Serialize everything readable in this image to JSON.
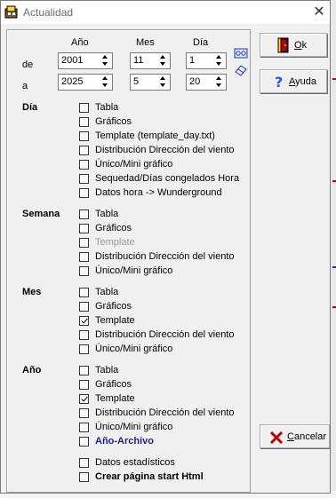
{
  "window": {
    "title": "Actualidad",
    "close_label": "✕"
  },
  "date_range": {
    "headers": {
      "year": "Año",
      "month": "Mes",
      "day": "Día"
    },
    "from_label": "de",
    "to_label": "a",
    "from": {
      "year": "2001",
      "month": "11",
      "day": "1"
    },
    "to": {
      "year": "2025",
      "month": "5",
      "day": "20"
    }
  },
  "buttons": {
    "ok": "Ok",
    "help": "Ayuda",
    "cancel": "Cancelar"
  },
  "sections": {
    "dia": {
      "title": "Día",
      "items": [
        {
          "label": "Tabla",
          "checked": false,
          "disabled": false
        },
        {
          "label": "Gráficos",
          "checked": false,
          "disabled": false
        },
        {
          "label": "Template (template_day.txt)",
          "checked": false,
          "disabled": false
        },
        {
          "label": "Distribución Dirección del viento",
          "checked": false,
          "disabled": false
        },
        {
          "label": "Único/Mini gráfico",
          "checked": false,
          "disabled": false
        },
        {
          "label": "Sequedad/Días congelados Hora",
          "checked": false,
          "disabled": false
        },
        {
          "label": "Datos hora -> Wunderground",
          "checked": false,
          "disabled": false
        }
      ]
    },
    "semana": {
      "title": "Semana",
      "items": [
        {
          "label": "Tabla",
          "checked": false,
          "disabled": false
        },
        {
          "label": "Gráficos",
          "checked": false,
          "disabled": false
        },
        {
          "label": "Template",
          "checked": false,
          "disabled": true
        },
        {
          "label": "Distribución Dirección del viento",
          "checked": false,
          "disabled": false
        },
        {
          "label": "Único/Mini gráfico",
          "checked": false,
          "disabled": false
        }
      ]
    },
    "mes": {
      "title": "Mes",
      "items": [
        {
          "label": "Tabla",
          "checked": false,
          "disabled": false
        },
        {
          "label": "Gráficos",
          "checked": false,
          "disabled": false
        },
        {
          "label": "Template",
          "checked": true,
          "disabled": false
        },
        {
          "label": "Distribución Dirección del viento",
          "checked": false,
          "disabled": false
        },
        {
          "label": "Único/Mini gráfico",
          "checked": false,
          "disabled": false
        }
      ]
    },
    "ano": {
      "title": "Año",
      "items": [
        {
          "label": "Tabla",
          "checked": false,
          "disabled": false
        },
        {
          "label": "Gráficos",
          "checked": false,
          "disabled": false
        },
        {
          "label": "Template",
          "checked": true,
          "disabled": false
        },
        {
          "label": "Distribución Dirección del viento",
          "checked": false,
          "disabled": false
        },
        {
          "label": "Único/Mini gráfico",
          "checked": false,
          "disabled": false
        },
        {
          "label": "Año-Archivo",
          "checked": false,
          "disabled": false
        }
      ]
    },
    "extra": {
      "items": [
        {
          "label": "Datos estadísticos",
          "checked": false,
          "disabled": false
        },
        {
          "label": "Crear página start Html",
          "checked": false,
          "disabled": false
        }
      ]
    }
  },
  "colors": {
    "accent_navy": "#1f1f8f",
    "cancel_x": "#c00000",
    "help_q": "#1e5bd8"
  },
  "icons": [
    "app-icon",
    "calendar-icon",
    "eraser-icon",
    "door-exit-icon",
    "help-question-icon",
    "cancel-x-icon",
    "close-icon"
  ]
}
